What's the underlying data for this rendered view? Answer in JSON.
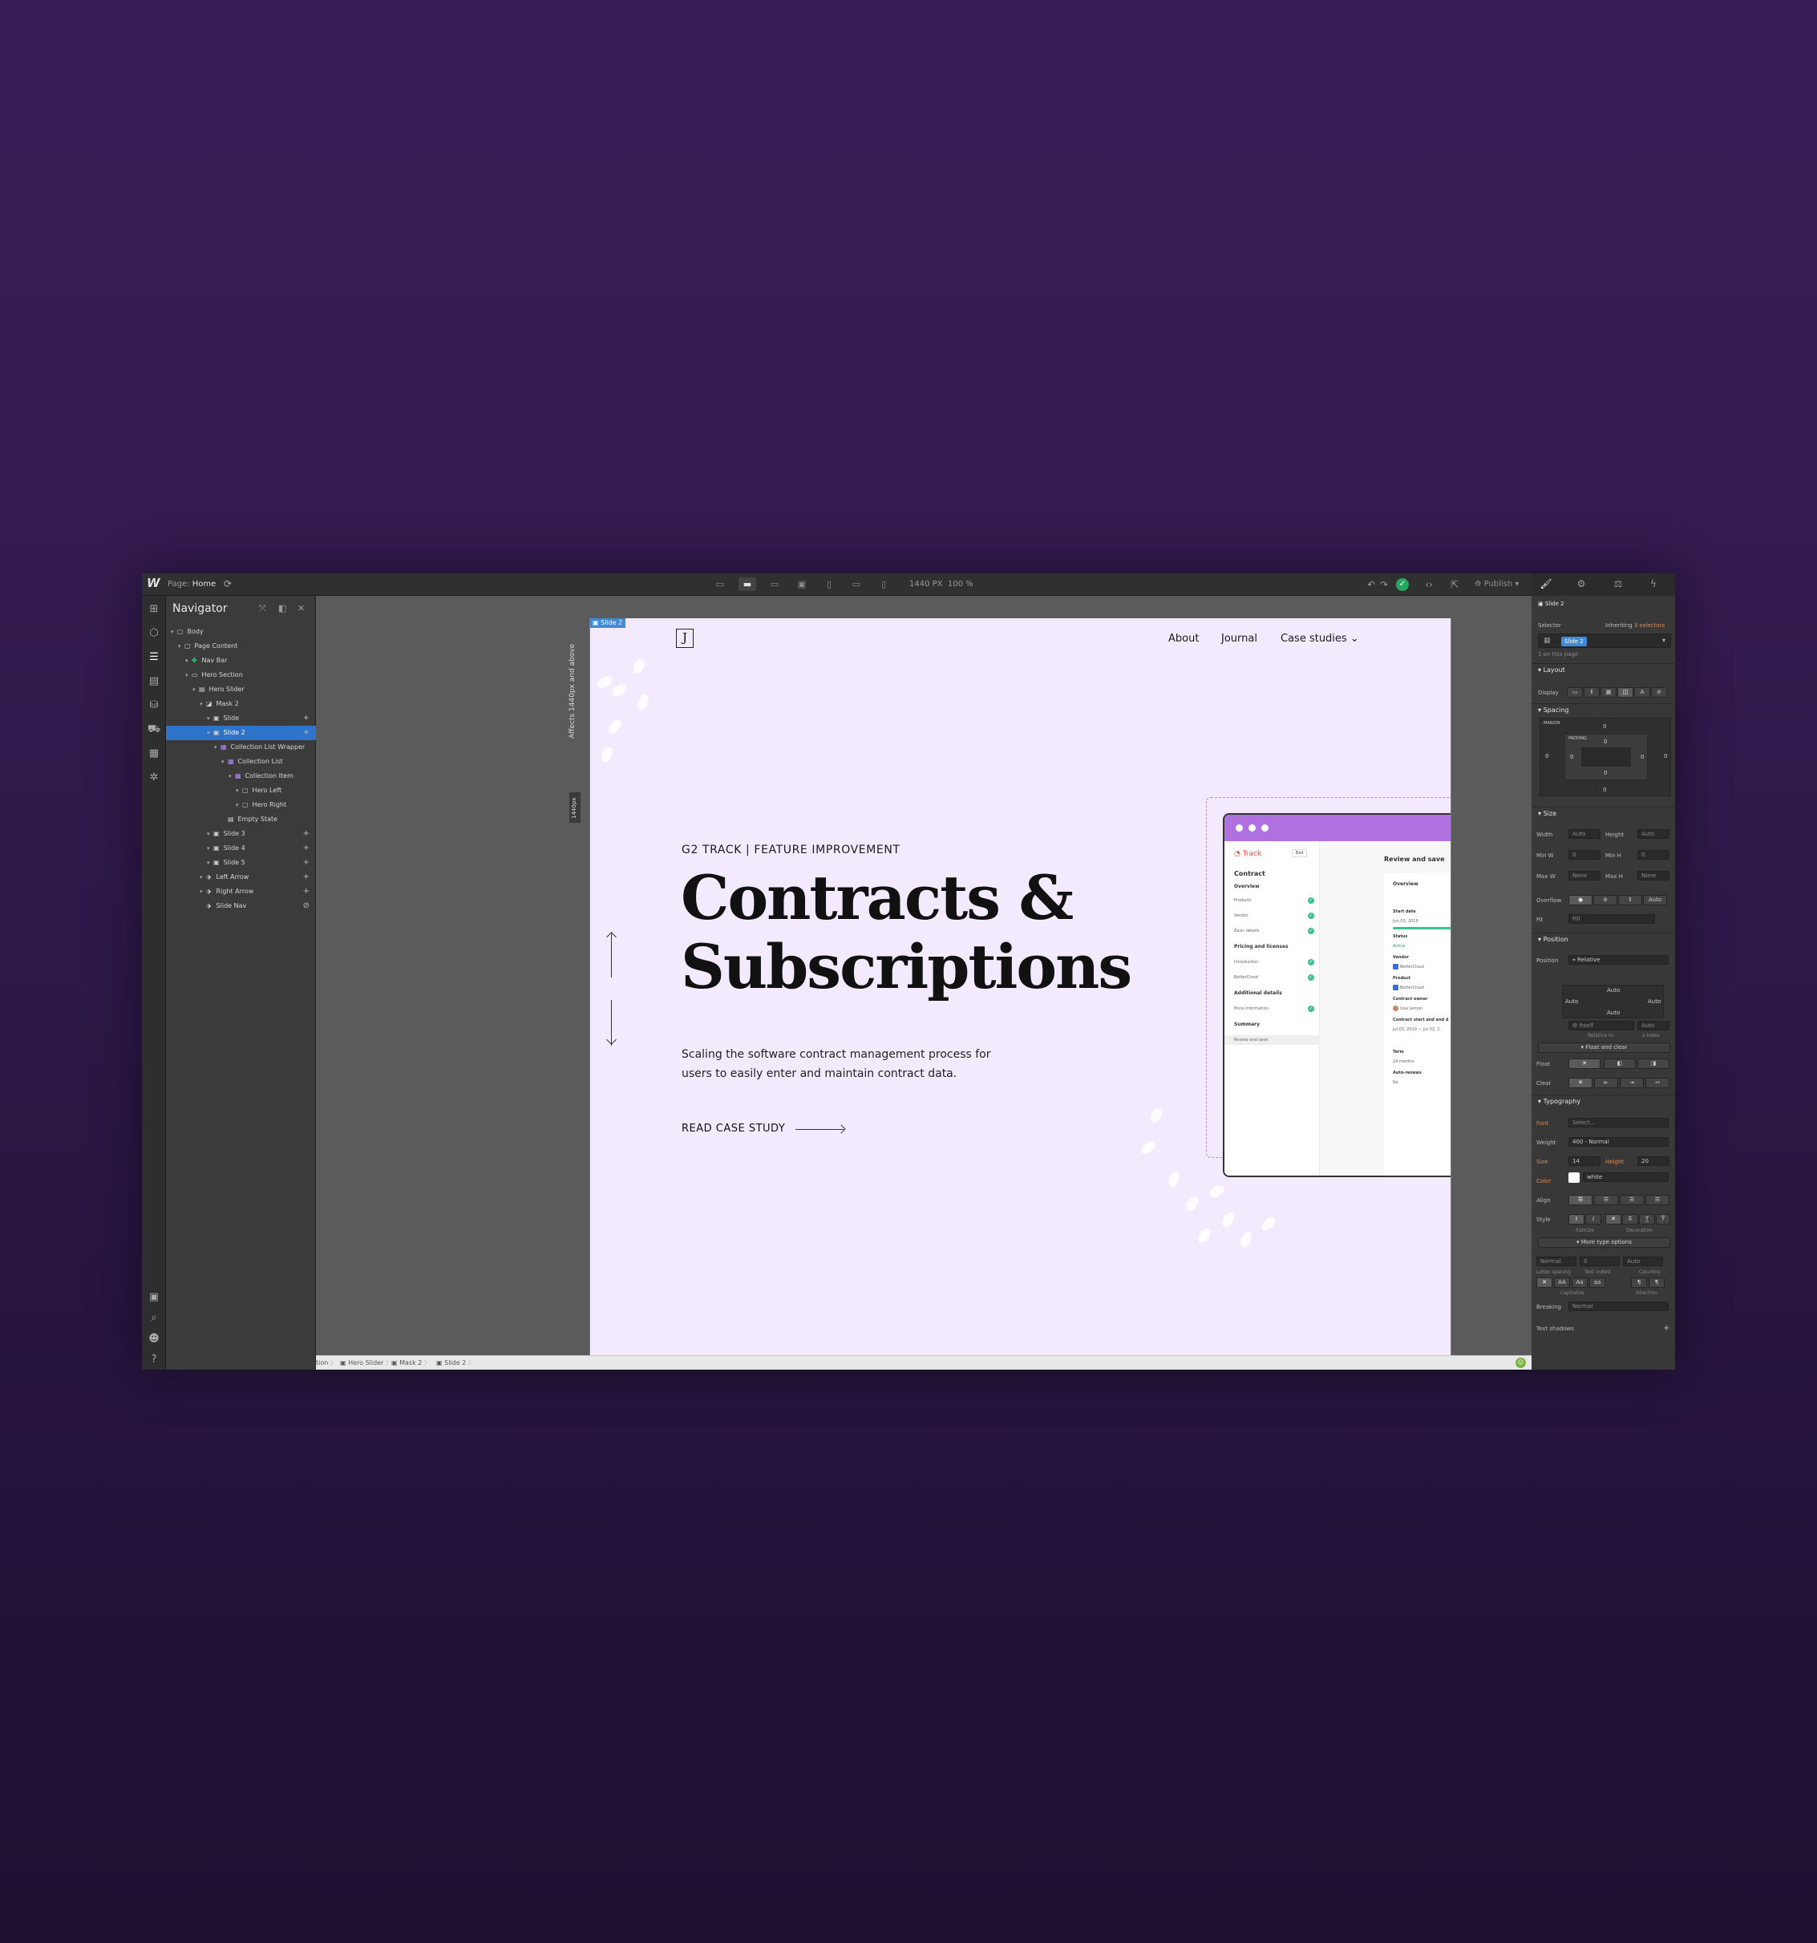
{
  "topbar": {
    "page_label": "Page:",
    "page_name": "Home",
    "width_px": "1440 PX",
    "zoom": "100 %",
    "publish": "Publish"
  },
  "navigator": {
    "title": "Navigator",
    "items": [
      {
        "label": "Body",
        "depth": 0,
        "icon": "body-icon"
      },
      {
        "label": "Page Content",
        "depth": 1,
        "icon": "div-icon"
      },
      {
        "label": "Nav Bar",
        "depth": 2,
        "icon": "symbol-icon"
      },
      {
        "label": "Hero Section",
        "depth": 2,
        "icon": "section-icon"
      },
      {
        "label": "Hero Slider",
        "depth": 3,
        "icon": "slider-icon"
      },
      {
        "label": "Mask 2",
        "depth": 4,
        "icon": "mask-icon"
      },
      {
        "label": "Slide",
        "depth": 5,
        "icon": "slide-icon"
      },
      {
        "label": "Slide 2",
        "depth": 5,
        "icon": "slide-icon",
        "selected": true
      },
      {
        "label": "Collection List Wrapper",
        "depth": 6,
        "icon": "collection-icon"
      },
      {
        "label": "Collection List",
        "depth": 7,
        "icon": "collection-icon"
      },
      {
        "label": "Collection Item",
        "depth": 8,
        "icon": "collection-icon"
      },
      {
        "label": "Hero Left",
        "depth": 9,
        "icon": "div-icon"
      },
      {
        "label": "Hero Right",
        "depth": 9,
        "icon": "div-icon"
      },
      {
        "label": "Empty State",
        "depth": 7,
        "icon": "empty-icon"
      },
      {
        "label": "Slide 3",
        "depth": 5,
        "icon": "slide-icon"
      },
      {
        "label": "Slide 4",
        "depth": 5,
        "icon": "slide-icon"
      },
      {
        "label": "Slide 5",
        "depth": 5,
        "icon": "slide-icon"
      },
      {
        "label": "Left Arrow",
        "depth": 4,
        "icon": "arrow-icon"
      },
      {
        "label": "Right Arrow",
        "depth": 4,
        "icon": "arrow-icon"
      },
      {
        "label": "Slide Nav",
        "depth": 4,
        "icon": "nav-icon"
      }
    ]
  },
  "canvas": {
    "selected_tag": "Slide 2",
    "affects_label": "Affects 1440px and above",
    "width_badge": "1440px"
  },
  "site": {
    "logo": "J",
    "nav": {
      "about": "About",
      "journal": "Journal",
      "case_studies": "Case studies"
    },
    "eyebrow": "G2 TRACK | FEATURE IMPROVEMENT",
    "headline_line1": "Contracts &",
    "headline_line2": "Subscriptions",
    "description": "Scaling the software contract management process for users to easily enter and maintain contract data.",
    "cta": "READ CASE STUDY",
    "mockup": {
      "brand": "Track",
      "exit": "Exit",
      "heading": "Contract",
      "sections": [
        {
          "label": "Overview",
          "bold": true
        },
        {
          "label": "Products",
          "check": true
        },
        {
          "label": "Vendor",
          "check": true
        },
        {
          "label": "Basic details",
          "check": true
        },
        {
          "label": "Pricing and licenses",
          "bold": true
        },
        {
          "label": "Introduction",
          "check": true
        },
        {
          "label": "BetterCloud",
          "check": true
        },
        {
          "label": "Additional details",
          "bold": true
        },
        {
          "label": "More information",
          "check": true
        },
        {
          "label": "Summary",
          "bold": true
        },
        {
          "label": "Review and save",
          "active": true
        }
      ],
      "review_title": "Review and save",
      "overview": "Overview",
      "fields": [
        {
          "label": "Start date",
          "value": "Jun 03, 2019"
        },
        {
          "label": "Status",
          "value": "Active"
        },
        {
          "label": "Vendor",
          "value": "BetterCloud"
        },
        {
          "label": "Product",
          "value": "BetterCloud"
        },
        {
          "label": "Contract owner",
          "value": "Lisa Lemon"
        },
        {
          "label": "Contract start and end d",
          "value": "Jul 03, 2019 — Jul 02, 2"
        },
        {
          "label": "Term",
          "value": "24 months"
        },
        {
          "label": "Auto-renews",
          "value": "No"
        }
      ]
    }
  },
  "breadcrumbs": [
    "tion",
    "Hero Slider",
    "Mask 2",
    "Slide 2"
  ],
  "style_panel": {
    "element": "Slide 2",
    "selector_label": "Selector",
    "inheriting": "Inheriting",
    "inheriting_count": "3 selectors",
    "selector_tag": "Slide 2",
    "on_page": "1 on this page",
    "layout": "Layout",
    "display": "Display",
    "spacing": "Spacing",
    "margin": "MARGIN",
    "padding": "PADDING",
    "zero": "0",
    "size": "Size",
    "width": "Width",
    "height": "Height",
    "min_w": "Min W",
    "min_h": "Min H",
    "max_w": "Max W",
    "max_h": "Max H",
    "auto": "Auto",
    "none": "None",
    "px": "PX",
    "overflow": "Overflow",
    "fit": "Fit",
    "fit_value": "Fill",
    "position_section": "Position",
    "position_label": "Position",
    "position_value": "Relative",
    "itself": "Itself",
    "relative_to": "Relative to",
    "z_index": "z-Index",
    "float_and_clear": "Float and clear",
    "float": "Float",
    "clear": "Clear",
    "typography": "Typography",
    "font": "Font",
    "font_value": "Select...",
    "weight": "Weight",
    "weight_value": "400 - Normal",
    "size_label": "Size",
    "size_value": "14",
    "height_label": "Height",
    "height_value": "20",
    "color": "Color",
    "color_value": "white",
    "align": "Align",
    "style": "Style",
    "italicize": "Italicize",
    "decoration": "Decoration",
    "more_type": "More type options",
    "normal": "Normal",
    "letter_spacing": "Letter spacing",
    "text_indent": "Text indent",
    "columns": "Columns",
    "capitalize": "Capitalize",
    "direction": "Direction",
    "breaking": "Breaking",
    "breaking_value": "Normal",
    "text_shadows": "Text shadows"
  },
  "colors": {
    "accent": "#3d8bd9",
    "site_bg": "#f4eafd",
    "mock_bar": "#b071e0",
    "ok_green": "#25a963"
  }
}
